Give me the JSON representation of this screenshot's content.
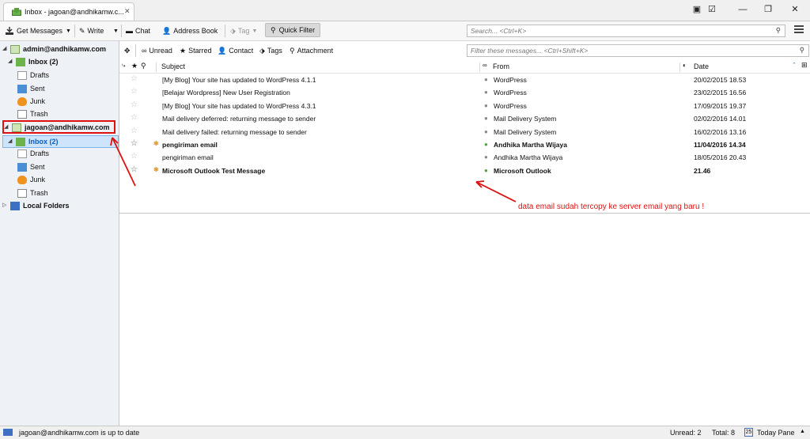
{
  "window": {
    "tab_title": "Inbox - jagoan@andhikamw.c...",
    "controls": {
      "minimize": "—",
      "maximize": "❐",
      "close": "✕"
    }
  },
  "toolbar": {
    "get_messages": "Get Messages",
    "write": "Write",
    "chat": "Chat",
    "address_book": "Address Book",
    "tag": "Tag",
    "quick_filter": "Quick Filter",
    "search_placeholder": "Search... <Ctrl+K>"
  },
  "filterbar": {
    "unread": "Unread",
    "starred": "Starred",
    "contact": "Contact",
    "tags": "Tags",
    "attachment": "Attachment",
    "filter_placeholder": "Filter these messages... <Ctrl+Shift+K>"
  },
  "folders": {
    "account1": {
      "name": "admin@andhikamw.com",
      "inbox": "Inbox (2)",
      "drafts": "Drafts",
      "sent": "Sent",
      "junk": "Junk",
      "trash": "Trash"
    },
    "account2": {
      "name": "jagoan@andhikamw.com",
      "inbox": "Inbox (2)",
      "drafts": "Drafts",
      "sent": "Sent",
      "junk": "Junk",
      "trash": "Trash"
    },
    "local": "Local Folders"
  },
  "columns": {
    "subject": "Subject",
    "from": "From",
    "date": "Date"
  },
  "messages": [
    {
      "subject": "[My Blog] Your site has updated to WordPress 4.1.1",
      "from": "WordPress",
      "date": "20/02/2015 18.53",
      "unread": false
    },
    {
      "subject": "[Belajar Wordpress] New User Registration",
      "from": "WordPress",
      "date": "23/02/2015 16.56",
      "unread": false
    },
    {
      "subject": "[My Blog] Your site has updated to WordPress 4.3.1",
      "from": "WordPress",
      "date": "17/09/2015 19.37",
      "unread": false
    },
    {
      "subject": "Mail delivery deferred: returning message to sender",
      "from": "Mail Delivery System",
      "date": "02/02/2016 14.01",
      "unread": false
    },
    {
      "subject": "Mail delivery failed: returning message to sender",
      "from": "Mail Delivery System",
      "date": "16/02/2016 13.16",
      "unread": false
    },
    {
      "subject": "pengiriman email",
      "from": "Andhika Martha Wijaya",
      "date": "11/04/2016 14.34",
      "unread": true
    },
    {
      "subject": "pengiriman email",
      "from": "Andhika Martha Wijaya",
      "date": "18/05/2016 20.43",
      "unread": false
    },
    {
      "subject": "Microsoft Outlook Test Message",
      "from": "Microsoft Outlook",
      "date": "21.46",
      "unread": true
    }
  ],
  "annotation": "data email sudah tercopy ke server email yang baru !",
  "status": {
    "message": "jagoan@andhikamw.com is up to date",
    "unread": "Unread: 2",
    "total": "Total: 8",
    "today_pane": "Today Pane",
    "calendar_day": "25"
  },
  "colors": {
    "annotation_red": "#e01010",
    "selection_blue": "#cde4fb",
    "online_green": "#4aa835"
  },
  "icons": [
    "inbox-icon",
    "get-messages-icon",
    "write-icon",
    "chat-icon",
    "address-book-icon",
    "tag-icon",
    "quick-filter-icon",
    "search-icon",
    "menu-icon",
    "star-icon",
    "attachment-icon",
    "folder-icon",
    "junk-icon",
    "trash-icon",
    "local-folders-icon"
  ]
}
